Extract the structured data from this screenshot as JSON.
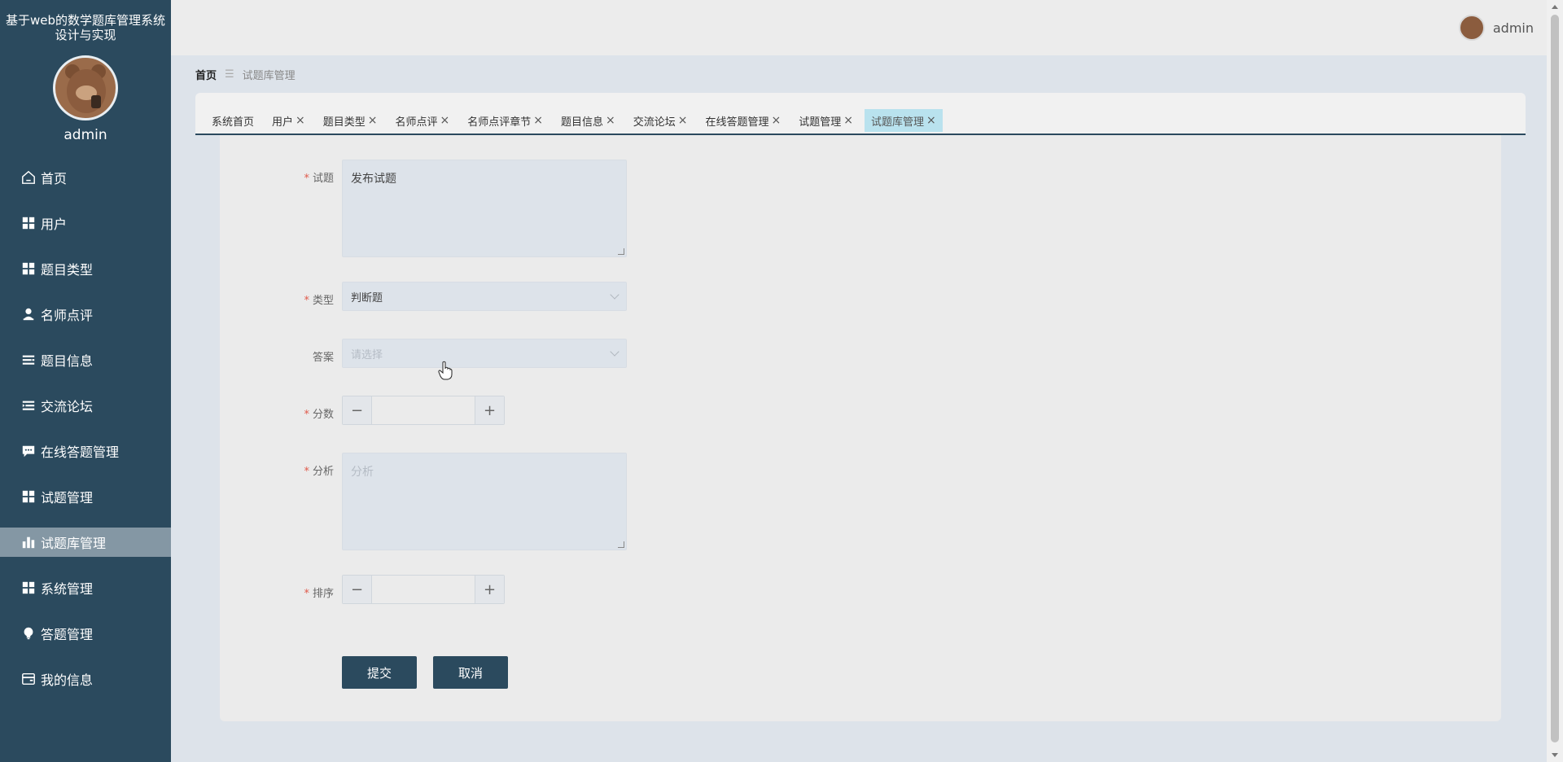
{
  "app": {
    "title": "基于web的数学题库管理系统设计与实现",
    "sidebar_username": "admin"
  },
  "menu": [
    {
      "label": "首页",
      "icon": "home-icon"
    },
    {
      "label": "用户",
      "icon": "grid-icon"
    },
    {
      "label": "题目类型",
      "icon": "grid-icon"
    },
    {
      "label": "名师点评",
      "icon": "user-icon"
    },
    {
      "label": "题目信息",
      "icon": "list-icon"
    },
    {
      "label": "交流论坛",
      "icon": "list-indent-icon"
    },
    {
      "label": "在线答题管理",
      "icon": "chat-icon"
    },
    {
      "label": "试题管理",
      "icon": "grid-icon"
    },
    {
      "label": "试题库管理",
      "icon": "bar-chart-icon",
      "active": true
    },
    {
      "label": "系统管理",
      "icon": "grid-icon"
    },
    {
      "label": "答题管理",
      "icon": "bulb-icon"
    },
    {
      "label": "我的信息",
      "icon": "card-icon"
    }
  ],
  "header": {
    "username": "admin"
  },
  "breadcrumb": {
    "home": "首页",
    "separator": "☰",
    "current": "试题库管理"
  },
  "tabs": [
    {
      "label": "系统首页",
      "closable": false
    },
    {
      "label": "用户",
      "closable": true
    },
    {
      "label": "题目类型",
      "closable": true
    },
    {
      "label": "名师点评",
      "closable": true
    },
    {
      "label": "名师点评章节",
      "closable": true
    },
    {
      "label": "题目信息",
      "closable": true
    },
    {
      "label": "交流论坛",
      "closable": true
    },
    {
      "label": "在线答题管理",
      "closable": true
    },
    {
      "label": "试题管理",
      "closable": true
    },
    {
      "label": "试题库管理",
      "closable": true,
      "active": true
    }
  ],
  "form": {
    "question": {
      "label": "试题",
      "required": true,
      "value": "发布试题"
    },
    "type": {
      "label": "类型",
      "required": true,
      "value": "判断题"
    },
    "answer": {
      "label": "答案",
      "required": false,
      "placeholder": "请选择"
    },
    "score": {
      "label": "分数",
      "required": true,
      "value": ""
    },
    "analysis": {
      "label": "分析",
      "required": true,
      "placeholder": "分析"
    },
    "order": {
      "label": "排序",
      "required": true,
      "value": ""
    },
    "submit_label": "提交",
    "cancel_label": "取消",
    "required_mark": "*",
    "minus": "−",
    "plus": "+"
  },
  "colors": {
    "sidebar_bg": "#2b4a5e",
    "active_menu": "#8497a4",
    "active_tab": "#b9e2ee",
    "required": "#e05a4b"
  }
}
